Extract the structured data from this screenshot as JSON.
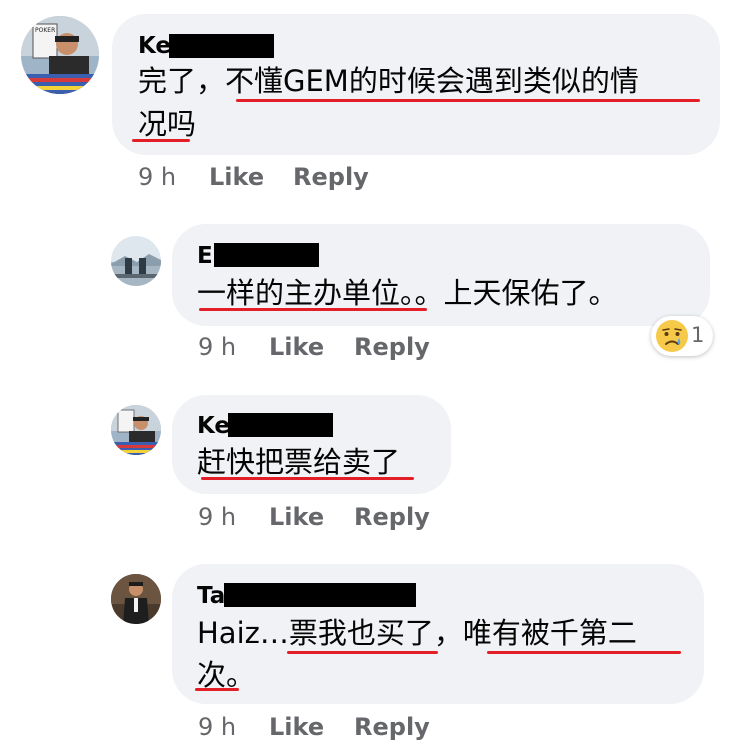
{
  "comments": [
    {
      "name": "Ke",
      "text_lines": [
        "完了，不懂GEM的时候会遇到类似的情",
        "况吗"
      ],
      "time": "9 h",
      "like": "Like",
      "reply": "Reply"
    },
    {
      "name": "E",
      "text_lines": [
        "一样的主办单位。。上天保佑了。"
      ],
      "time": "9 h",
      "like": "Like",
      "reply": "Reply",
      "reaction": {
        "icon": "sad-face-icon",
        "count": "1"
      }
    },
    {
      "name": "Ke",
      "text_lines": [
        "赶快把票给卖了"
      ],
      "time": "9 h",
      "like": "Like",
      "reply": "Reply"
    },
    {
      "name": "Ta",
      "text_lines": [
        "Haiz…票我也买了，唯有被千第二",
        "次。"
      ],
      "time": "9 h",
      "like": "Like",
      "reply": "Reply"
    }
  ],
  "colors": {
    "bubble": "#f0f2f5",
    "underline": "#e41e26",
    "meta": "#65676b"
  }
}
